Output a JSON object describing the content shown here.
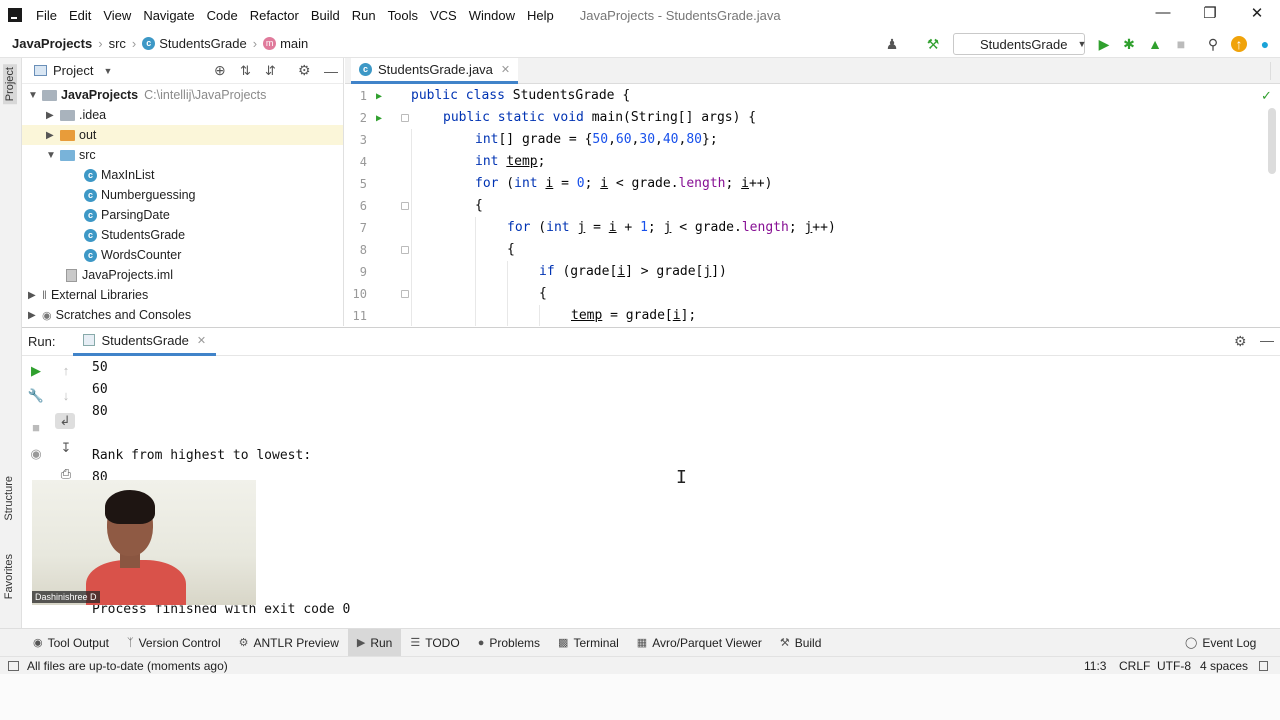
{
  "menubar": {
    "items": [
      "File",
      "Edit",
      "View",
      "Navigate",
      "Code",
      "Refactor",
      "Build",
      "Run",
      "Tools",
      "VCS",
      "Window",
      "Help"
    ],
    "window_title": "JavaProjects - StudentsGrade.java"
  },
  "navbar": {
    "crumbs": [
      "JavaProjects",
      "src",
      "StudentsGrade",
      "main"
    ],
    "run_config": "StudentsGrade"
  },
  "left_strip": {
    "project_tab": "Project",
    "structure_tab": "Structure",
    "favorites_tab": "Favorites"
  },
  "project": {
    "header": "Project",
    "root_name": "JavaProjects",
    "root_path": "C:\\intellij\\JavaProjects",
    "idea": ".idea",
    "out": "out",
    "src": "src",
    "classes": [
      "MaxInList",
      "Numberguessing",
      "ParsingDate",
      "StudentsGrade",
      "WordsCounter"
    ],
    "iml": "JavaProjects.iml",
    "external_libraries": "External Libraries",
    "scratches": "Scratches and Consoles"
  },
  "editor": {
    "tab": "StudentsGrade.java",
    "line_numbers": [
      "1",
      "2",
      "3",
      "4",
      "5",
      "6",
      "7",
      "8",
      "9",
      "10",
      "11"
    ]
  },
  "run": {
    "label": "Run:",
    "tab": "StudentsGrade",
    "output": [
      "50",
      "60",
      "80",
      "",
      "Rank from highest to lowest:",
      "80"
    ],
    "exit_line": "Process finished with exit code 0"
  },
  "webcam": {
    "name": "Dashinishree D"
  },
  "bottom_tools": [
    "Tool Output",
    "Version Control",
    "ANTLR Preview",
    "Run",
    "TODO",
    "Problems",
    "Terminal",
    "Avro/Parquet Viewer",
    "Build"
  ],
  "event_log": "Event Log",
  "status": {
    "message": "All files are up-to-date (moments ago)",
    "position": "11:3",
    "line_sep": "CRLF",
    "encoding": "UTF-8",
    "indent": "4 spaces"
  },
  "colors": {
    "accent": "#4083c9",
    "run_green": "#30a02e",
    "keyword": "#0033b3",
    "number": "#1750eb",
    "field": "#871094"
  }
}
